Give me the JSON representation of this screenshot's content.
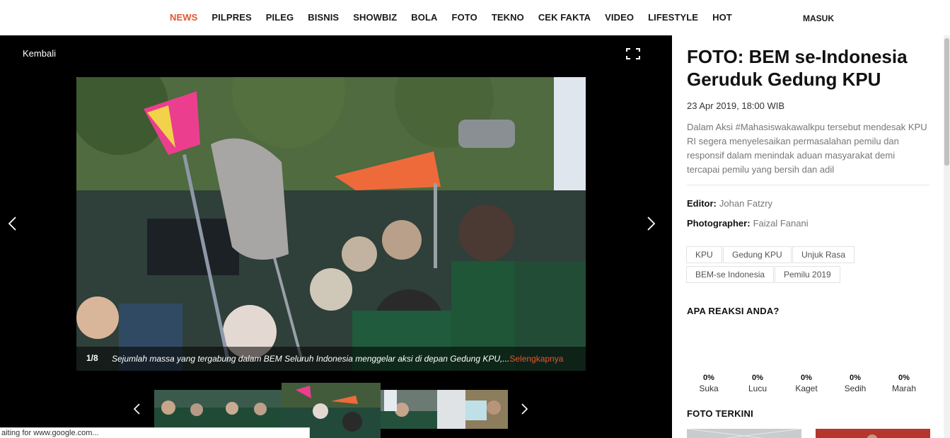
{
  "nav": {
    "items": [
      {
        "label": "NEWS",
        "active": true
      },
      {
        "label": "PILPRES"
      },
      {
        "label": "PILEG"
      },
      {
        "label": "BISNIS"
      },
      {
        "label": "SHOWBIZ"
      },
      {
        "label": "BOLA"
      },
      {
        "label": "FOTO"
      },
      {
        "label": "TEKNO"
      },
      {
        "label": "CEK FAKTA"
      },
      {
        "label": "VIDEO"
      },
      {
        "label": "LIFESTYLE"
      },
      {
        "label": "HOT"
      }
    ],
    "login_label": "MASUK"
  },
  "viewer": {
    "back_label": "Kembali",
    "counter": "1/8",
    "caption": "Sejumlah massa yang tergabung dalam BEM Seluruh Indonesia menggelar aksi di depan Gedung KPU,...",
    "more_label": "Selengkapnya",
    "status_text": "aiting for www.google.com..."
  },
  "article": {
    "title": "FOTO: BEM se-Indonesia Geruduk Gedung KPU",
    "date": "23 Apr 2019, 18:00 WIB",
    "description": "Dalam Aksi #Mahasiswakawalkpu tersebut mendesak KPU RI segera menyelesaikan permasalahan pemilu dan responsif dalam menindak aduan masyarakat demi tercapai pemilu yang bersih dan adil",
    "editor_label": "Editor:",
    "editor_name": "Johan Fatzry",
    "photographer_label": "Photographer:",
    "photographer_name": "Faizal Fanani",
    "tags": [
      "KPU",
      "Gedung KPU",
      "Unjuk Rasa",
      "BEM-se Indonesia",
      "Pemilu 2019"
    ]
  },
  "reactions": {
    "heading": "APA REAKSI ANDA?",
    "items": [
      {
        "pct": "0%",
        "label": "Suka"
      },
      {
        "pct": "0%",
        "label": "Lucu"
      },
      {
        "pct": "0%",
        "label": "Kaget"
      },
      {
        "pct": "0%",
        "label": "Sedih"
      },
      {
        "pct": "0%",
        "label": "Marah"
      }
    ]
  },
  "recent": {
    "heading": "FOTO TERKINI"
  },
  "colors": {
    "accent": "#e4572e",
    "viewer_bg": "#000000"
  }
}
